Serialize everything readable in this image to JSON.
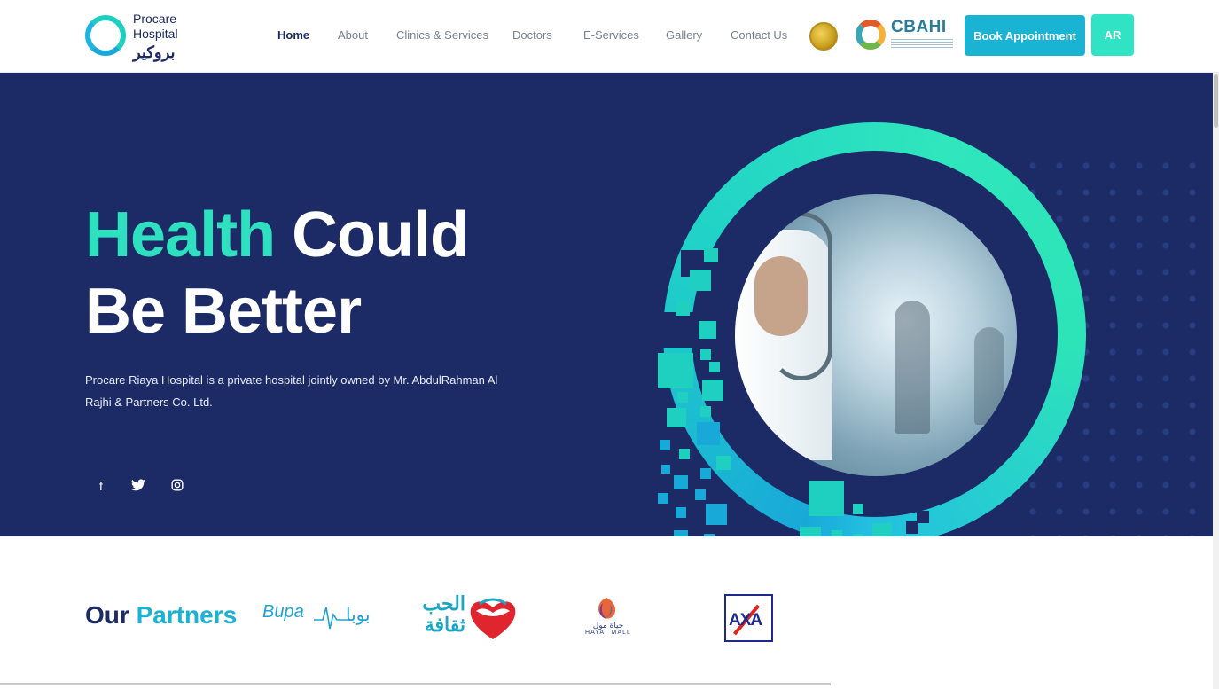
{
  "header": {
    "logo": {
      "line1": "Procare",
      "line2": "Hospital",
      "arabic": "بروكير"
    },
    "nav": [
      {
        "label": "Home",
        "active": true
      },
      {
        "label": "About"
      },
      {
        "label": "Clinics & Services"
      },
      {
        "label": "Doctors"
      },
      {
        "label": "E-Services"
      },
      {
        "label": "Gallery"
      },
      {
        "label": "Contact Us"
      }
    ],
    "accreditation": {
      "cbahi": "CBAHI"
    },
    "book_button": "Book Appointment",
    "lang_button": "AR"
  },
  "hero": {
    "title_accent": "Health",
    "title_rest": "Could",
    "title_line2": "Be Better",
    "description": "Procare Riaya Hospital is a private hospital jointly owned by Mr. AbdulRahman Al Rajhi & Partners Co. Ltd.",
    "social": [
      {
        "icon": "facebook-icon",
        "glyph": "f"
      },
      {
        "icon": "twitter-icon",
        "glyph": "🐦"
      },
      {
        "icon": "instagram-icon",
        "glyph": "◎"
      }
    ]
  },
  "partners": {
    "title_a": "Our",
    "title_b": "Partners",
    "logos": [
      {
        "name": "Bupa",
        "text": "Bupa",
        "arabic": "بوبا"
      },
      {
        "name": "Hob Thaqafa",
        "arabic_line1": "الحب",
        "arabic_line2": "ثقافة"
      },
      {
        "name": "Hayat Mall",
        "sub": "HAYAT MALL"
      },
      {
        "name": "AXA",
        "text": "AXA"
      }
    ]
  },
  "colors": {
    "navy": "#1c2a66",
    "teal": "#2fe0c0",
    "cyan": "#1ab3d3",
    "ar_button": "#2fe3c4"
  }
}
